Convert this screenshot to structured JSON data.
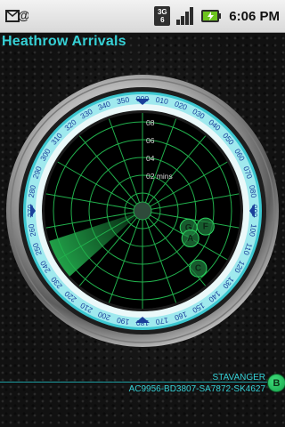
{
  "status_bar": {
    "network_top": "3G",
    "network_bottom": "6",
    "time": "6:06 PM",
    "icons": [
      "notification-icon",
      "data-3g-icon",
      "signal-strength-icon",
      "battery-charging-icon"
    ]
  },
  "app": {
    "title": "Heathrow Arrivals"
  },
  "radar": {
    "compass_labels": [
      "000",
      "010",
      "020",
      "030",
      "040",
      "050",
      "060",
      "070",
      "080",
      "090",
      "100",
      "110",
      "120",
      "130",
      "140",
      "150",
      "160",
      "170",
      "180",
      "190",
      "200",
      "210",
      "220",
      "230",
      "240",
      "250",
      "260",
      "270",
      "280",
      "290",
      "300",
      "310",
      "320",
      "330",
      "340",
      "350"
    ],
    "range_labels": [
      "08",
      "06",
      "04",
      "02 mins"
    ],
    "aircraft": [
      {
        "label": "G"
      },
      {
        "label": "F"
      },
      {
        "label": "A"
      },
      {
        "label": "C"
      }
    ],
    "colors": {
      "grid": "#21b04c",
      "sweep": "#2bd660",
      "bezel_ring": "#36c8d2",
      "label": "#1a3f9a"
    }
  },
  "footer": {
    "region": "STAVANGER",
    "flights": "AC9956-BD3807-SA7872-SK4627",
    "selected_marker": "B"
  }
}
